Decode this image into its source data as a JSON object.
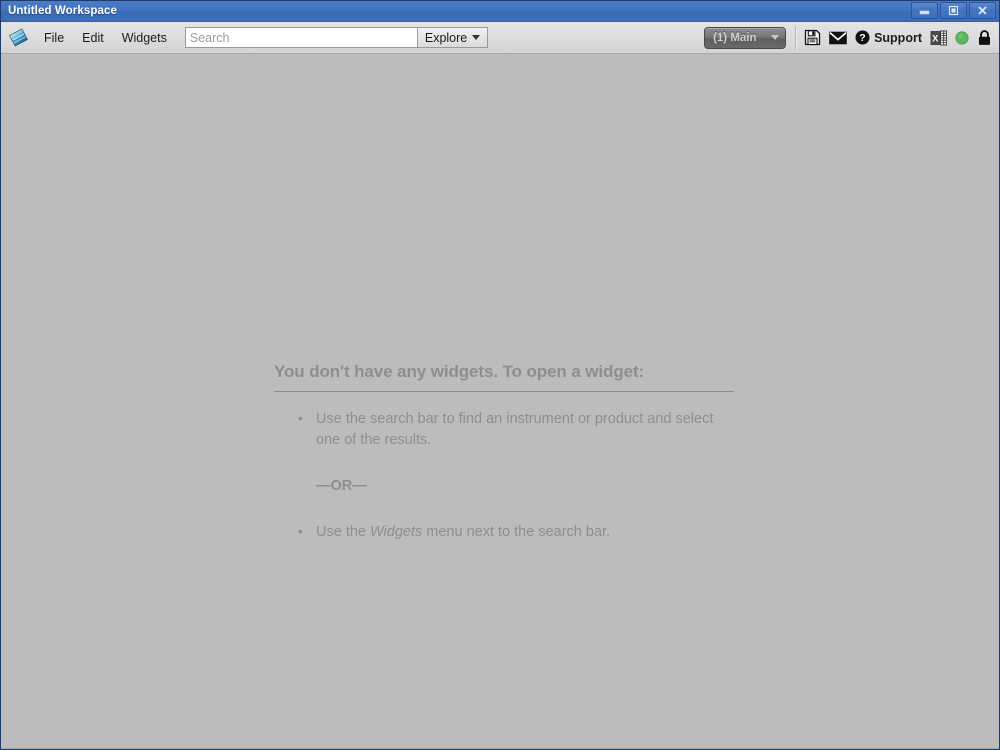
{
  "window": {
    "title": "Untitled Workspace",
    "controls": [
      {
        "name": "minimize",
        "label": "–"
      },
      {
        "name": "maximize",
        "label": "□"
      },
      {
        "name": "close",
        "label": "X"
      }
    ]
  },
  "toolbar": {
    "logo_icon": "app-diamond-logo-icon",
    "menus": [
      {
        "label": "File"
      },
      {
        "label": "Edit"
      },
      {
        "label": "Widgets"
      }
    ],
    "search": {
      "placeholder": "Search",
      "value": ""
    },
    "explore": {
      "label": "Explore",
      "caret_icon": "chevron-down-icon"
    },
    "workspace_selector": {
      "label": "(1) Main",
      "caret_icon": "chevron-down-icon"
    },
    "icons": [
      {
        "name": "save-icon",
        "title": "Save"
      },
      {
        "name": "mail-icon",
        "title": "Mail"
      },
      {
        "name": "excel-export-icon",
        "title": "Excel"
      },
      {
        "name": "status-online-icon",
        "title": "Online"
      },
      {
        "name": "lock-icon",
        "title": "Lock"
      }
    ],
    "support": {
      "label": "Support",
      "icon": "help-question-icon"
    }
  },
  "empty_state": {
    "heading": "You don't have any widgets. To open a widget:",
    "bullet_1": "Use the search bar to find an instrument or product and select one of the results.",
    "or_separator": "—OR—",
    "bullet_2_prefix": "Use the ",
    "bullet_2_emphasis": "Widgets",
    "bullet_2_suffix": " menu next to the search bar."
  },
  "colors": {
    "titlebar_blue": "#3f70bd",
    "frame_blue": "#3a68b0",
    "toolbar_gray": "#dcdcdc",
    "content_gray": "#bcbcbc",
    "empty_text_gray": "#8e8e8e",
    "status_green": "#5cb85c"
  }
}
